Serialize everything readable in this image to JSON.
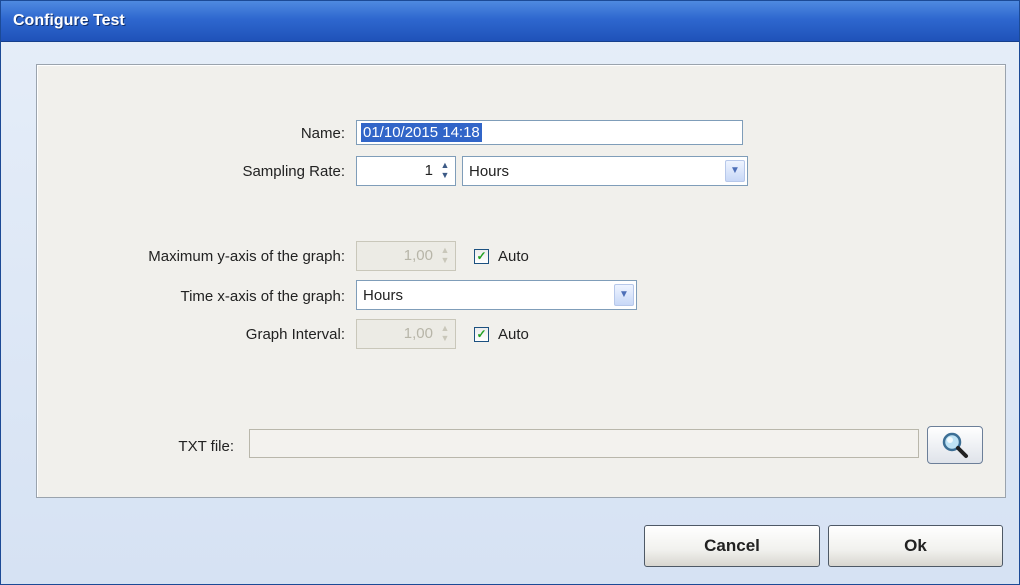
{
  "window": {
    "title": "Configure Test"
  },
  "form": {
    "name": {
      "label": "Name:",
      "value": "01/10/2015 14:18"
    },
    "sampling_rate": {
      "label": "Sampling Rate:",
      "value": "1",
      "unit": "Hours"
    },
    "max_y_axis": {
      "label": "Maximum y-axis of the graph:",
      "value": "1,00",
      "auto_label": "Auto",
      "auto_checked": true
    },
    "time_x_axis": {
      "label": "Time x-axis of the graph:",
      "value": "Hours"
    },
    "graph_interval": {
      "label": "Graph Interval:",
      "value": "1,00",
      "auto_label": "Auto",
      "auto_checked": true
    },
    "txt_file": {
      "label": "TXT file:",
      "value": ""
    }
  },
  "buttons": {
    "cancel": "Cancel",
    "ok": "Ok"
  },
  "icons": {
    "browse": "magnifier-icon",
    "dropdown": "chevron-down-icon",
    "spinner": "spin-arrows-icon",
    "check": "checkmark-icon"
  },
  "colors": {
    "titlebar": "#2e67cf",
    "selection": "#3165c8",
    "panel": "#f1f0ec",
    "check": "#21a121"
  }
}
